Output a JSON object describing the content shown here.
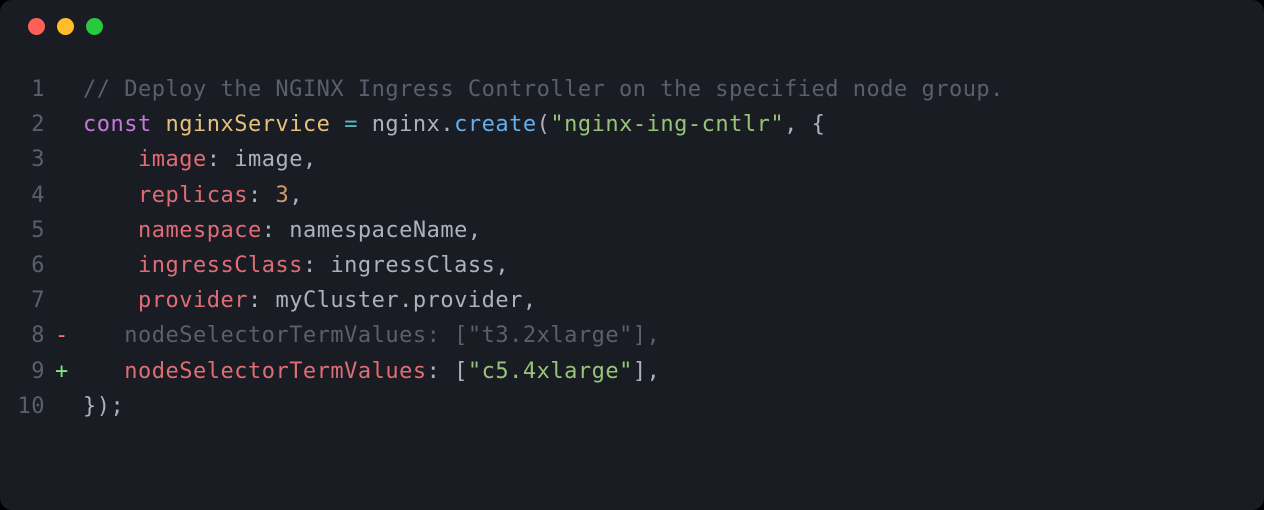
{
  "window": {
    "traffic_lights": [
      "red",
      "yellow",
      "green"
    ]
  },
  "code": {
    "lines": [
      {
        "n": "1",
        "gutter": "",
        "tokens": [
          {
            "c": "tok-comment",
            "t": "// Deploy the NGINX Ingress Controller on the specified node group."
          }
        ]
      },
      {
        "n": "2",
        "gutter": "",
        "tokens": [
          {
            "c": "tok-keyword",
            "t": "const"
          },
          {
            "c": "",
            "t": " "
          },
          {
            "c": "tok-ident",
            "t": "nginxService"
          },
          {
            "c": "",
            "t": " "
          },
          {
            "c": "tok-op",
            "t": "="
          },
          {
            "c": "",
            "t": " "
          },
          {
            "c": "tok-prop",
            "t": "nginx"
          },
          {
            "c": "tok-punct",
            "t": "."
          },
          {
            "c": "tok-call",
            "t": "create"
          },
          {
            "c": "tok-punct",
            "t": "("
          },
          {
            "c": "tok-string",
            "t": "\"nginx-ing-cntlr\""
          },
          {
            "c": "tok-punct",
            "t": ", {"
          }
        ]
      },
      {
        "n": "3",
        "gutter": "",
        "tokens": [
          {
            "c": "",
            "t": "    "
          },
          {
            "c": "tok-key",
            "t": "image"
          },
          {
            "c": "tok-punct",
            "t": ": "
          },
          {
            "c": "tok-prop",
            "t": "image"
          },
          {
            "c": "tok-punct",
            "t": ","
          }
        ]
      },
      {
        "n": "4",
        "gutter": "",
        "tokens": [
          {
            "c": "",
            "t": "    "
          },
          {
            "c": "tok-key",
            "t": "replicas"
          },
          {
            "c": "tok-punct",
            "t": ": "
          },
          {
            "c": "tok-number",
            "t": "3"
          },
          {
            "c": "tok-punct",
            "t": ","
          }
        ]
      },
      {
        "n": "5",
        "gutter": "",
        "tokens": [
          {
            "c": "",
            "t": "    "
          },
          {
            "c": "tok-key",
            "t": "namespace"
          },
          {
            "c": "tok-punct",
            "t": ": "
          },
          {
            "c": "tok-prop",
            "t": "namespaceName"
          },
          {
            "c": "tok-punct",
            "t": ","
          }
        ]
      },
      {
        "n": "6",
        "gutter": "",
        "tokens": [
          {
            "c": "",
            "t": "    "
          },
          {
            "c": "tok-key",
            "t": "ingressClass"
          },
          {
            "c": "tok-punct",
            "t": ": "
          },
          {
            "c": "tok-prop",
            "t": "ingressClass"
          },
          {
            "c": "tok-punct",
            "t": ","
          }
        ]
      },
      {
        "n": "7",
        "gutter": "",
        "tokens": [
          {
            "c": "",
            "t": "    "
          },
          {
            "c": "tok-key",
            "t": "provider"
          },
          {
            "c": "tok-punct",
            "t": ": "
          },
          {
            "c": "tok-prop",
            "t": "myCluster"
          },
          {
            "c": "tok-punct",
            "t": "."
          },
          {
            "c": "tok-prop",
            "t": "provider"
          },
          {
            "c": "tok-punct",
            "t": ","
          }
        ]
      },
      {
        "n": "8",
        "gutter": "-",
        "gutterClass": "gutter-minus",
        "dim": true,
        "tokens": [
          {
            "c": "tok-dim",
            "t": "   nodeSelectorTermValues: [\"t3.2xlarge\"],"
          }
        ]
      },
      {
        "n": "9",
        "gutter": "+",
        "gutterClass": "gutter-plus",
        "tokens": [
          {
            "c": "",
            "t": "   "
          },
          {
            "c": "tok-key",
            "t": "nodeSelectorTermValues"
          },
          {
            "c": "tok-punct",
            "t": ": ["
          },
          {
            "c": "tok-string",
            "t": "\"c5.4xlarge\""
          },
          {
            "c": "tok-punct",
            "t": "],"
          }
        ]
      },
      {
        "n": "10",
        "gutter": "",
        "tokens": [
          {
            "c": "tok-punct",
            "t": "});"
          }
        ]
      }
    ]
  }
}
